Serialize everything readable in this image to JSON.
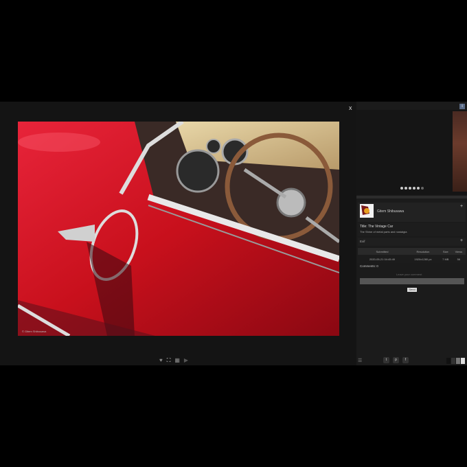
{
  "viewer": {
    "close_label": "x",
    "photo_credit": "© Gitem Shibusawa"
  },
  "bottom_bar": {
    "heart_icon": "♥",
    "fullscreen_icon": "⛶",
    "grid_icon": "▦",
    "play_icon": "▶"
  },
  "sidebar": {
    "info_label": "i",
    "user": {
      "name": "Gitem Shibusawa"
    },
    "plus": "+",
    "title": "Title: The Vintage Car",
    "subtitle": "The Shine of metal parts and nostalgia",
    "exif_label": "Exif",
    "table": {
      "headers": [
        "Submitted",
        "Resolution",
        "Size",
        "Views"
      ],
      "row": [
        "2020-05-21 04:45:49",
        "1920x1280 px",
        "7 MB",
        "56"
      ]
    },
    "comments_label": "Comments: 0",
    "leave_comment": "Leave your comment",
    "send_label": "Send",
    "share": {
      "twitter": "t",
      "pinterest": "p",
      "facebook": "f"
    },
    "list_icon": "☰"
  },
  "colors": {
    "car_red": "#c8101c",
    "background": "#141414",
    "sidebar": "#1b1b1b"
  }
}
